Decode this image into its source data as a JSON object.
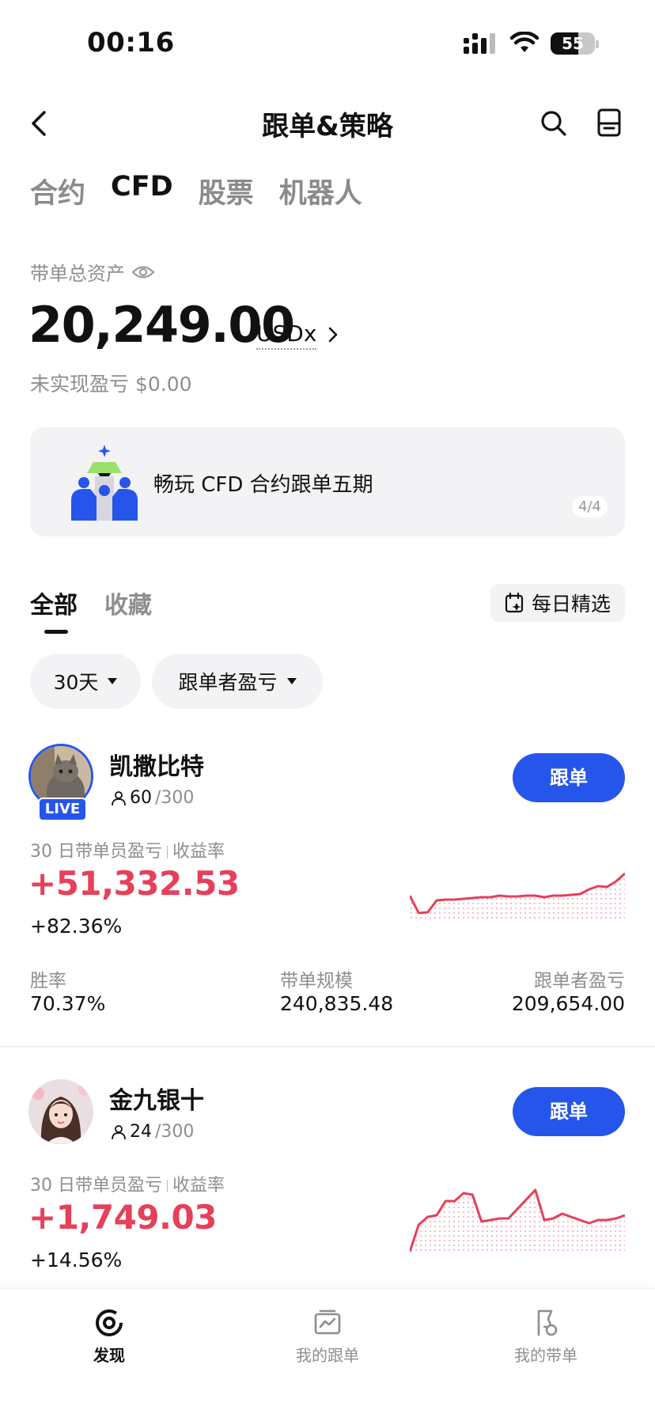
{
  "status_bar": {
    "time": "00:16",
    "battery": "55"
  },
  "header": {
    "title": "跟单&策略"
  },
  "category_tabs": [
    {
      "label": "合约",
      "active": false
    },
    {
      "label": "CFD",
      "active": true
    },
    {
      "label": "股票",
      "active": false
    },
    {
      "label": "机器人",
      "active": false
    }
  ],
  "assets": {
    "label": "带单总资产",
    "value": "20,249.00",
    "unit": "USDx",
    "unrealized": "未实现盈亏 $0.00"
  },
  "banner": {
    "text": "畅玩 CFD 合约跟单五期",
    "page": "4/4"
  },
  "list_tabs": {
    "all": "全部",
    "favorites": "收藏",
    "daily_pick": "每日精选"
  },
  "filters": {
    "period": "30天",
    "sort": "跟单者盈亏"
  },
  "traders": [
    {
      "name": "凯撒比特",
      "live_badge": "LIVE",
      "followers": "60",
      "max_followers": "/300",
      "follow_label": "跟单",
      "metric_label_a": "30 日带单员盈亏",
      "metric_label_b": "收益率",
      "pnl": "+51,332.53",
      "roi": "+82.36%",
      "stats": {
        "win_rate_label": "胜率",
        "win_rate": "70.37%",
        "aum_label": "带单规模",
        "aum": "240,835.48",
        "follower_pnl_label": "跟单者盈亏",
        "follower_pnl": "209,654.00"
      },
      "sparkline": [
        58,
        80,
        79,
        64,
        63,
        63,
        62,
        61,
        60,
        60,
        58,
        59,
        59,
        58,
        58,
        60,
        58,
        58,
        57,
        56,
        50,
        46,
        47,
        40,
        30
      ]
    },
    {
      "name": "金九银十",
      "live_badge": "",
      "followers": "24",
      "max_followers": "/300",
      "follow_label": "跟单",
      "metric_label_a": "30 日带单员盈亏",
      "metric_label_b": "收益率",
      "pnl": "+1,749.03",
      "roi": "+14.56%",
      "sparkline": [
        88,
        54,
        44,
        42,
        24,
        24,
        14,
        16,
        50,
        48,
        46,
        46,
        34,
        22,
        10,
        48,
        46,
        40,
        44,
        48,
        52,
        48,
        48,
        46,
        42
      ]
    }
  ],
  "bottom_nav": [
    {
      "label": "发现",
      "icon": "discover-icon",
      "active": true
    },
    {
      "label": "我的跟单",
      "icon": "chart-folder-icon",
      "active": false
    },
    {
      "label": "我的带单",
      "icon": "flag-badge-icon",
      "active": false
    }
  ],
  "colors": {
    "accent": "#2555ea",
    "profit": "#e6405a",
    "muted": "#8e8e8e"
  }
}
